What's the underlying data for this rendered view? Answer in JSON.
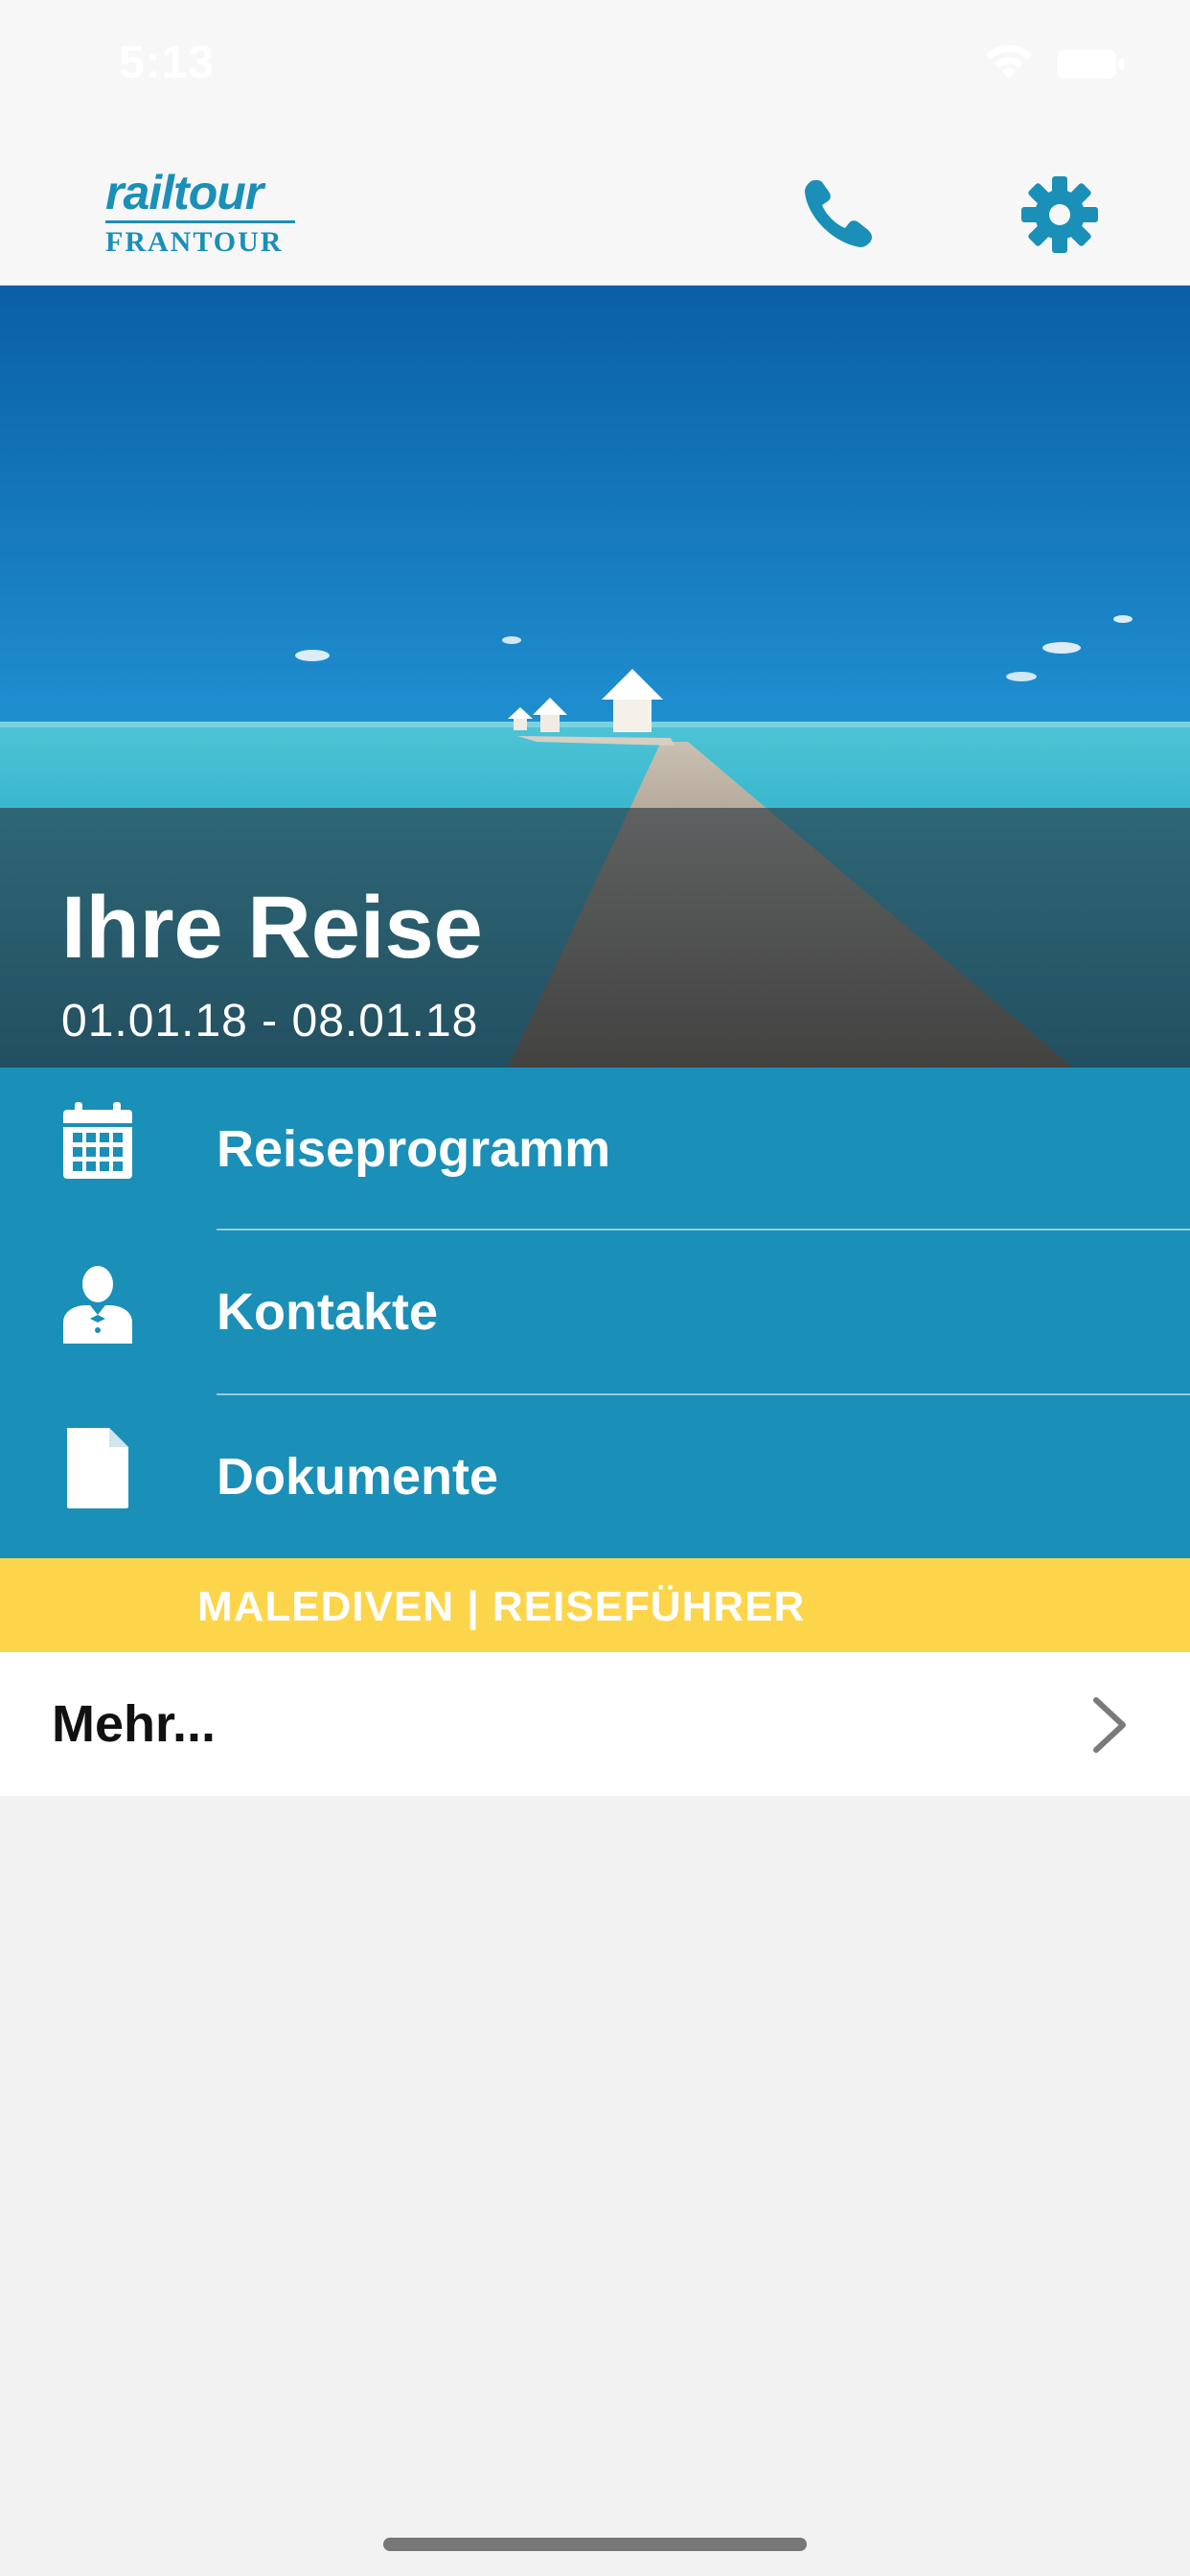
{
  "status_bar": {
    "time": "5:13"
  },
  "header": {
    "logo_top": "railtour",
    "logo_bottom": "FRANTOUR",
    "phone_icon": "phone-icon",
    "settings_icon": "gear-icon",
    "accent_color": "#1a8fb8"
  },
  "hero": {
    "title": "Ihre Reise",
    "dates": "01.01.18 - 08.01.18"
  },
  "menu": {
    "items": [
      {
        "label": "Reiseprogramm",
        "icon": "calendar-icon"
      },
      {
        "label": "Kontakte",
        "icon": "person-icon"
      },
      {
        "label": "Dokumente",
        "icon": "document-icon"
      }
    ],
    "background_color": "#1a8fb8"
  },
  "banner": {
    "label": "MALEDIVEN | REISEFÜHRER",
    "color": "#fdd54a"
  },
  "more": {
    "label": "Mehr...",
    "icon": "chevron-right-icon"
  }
}
